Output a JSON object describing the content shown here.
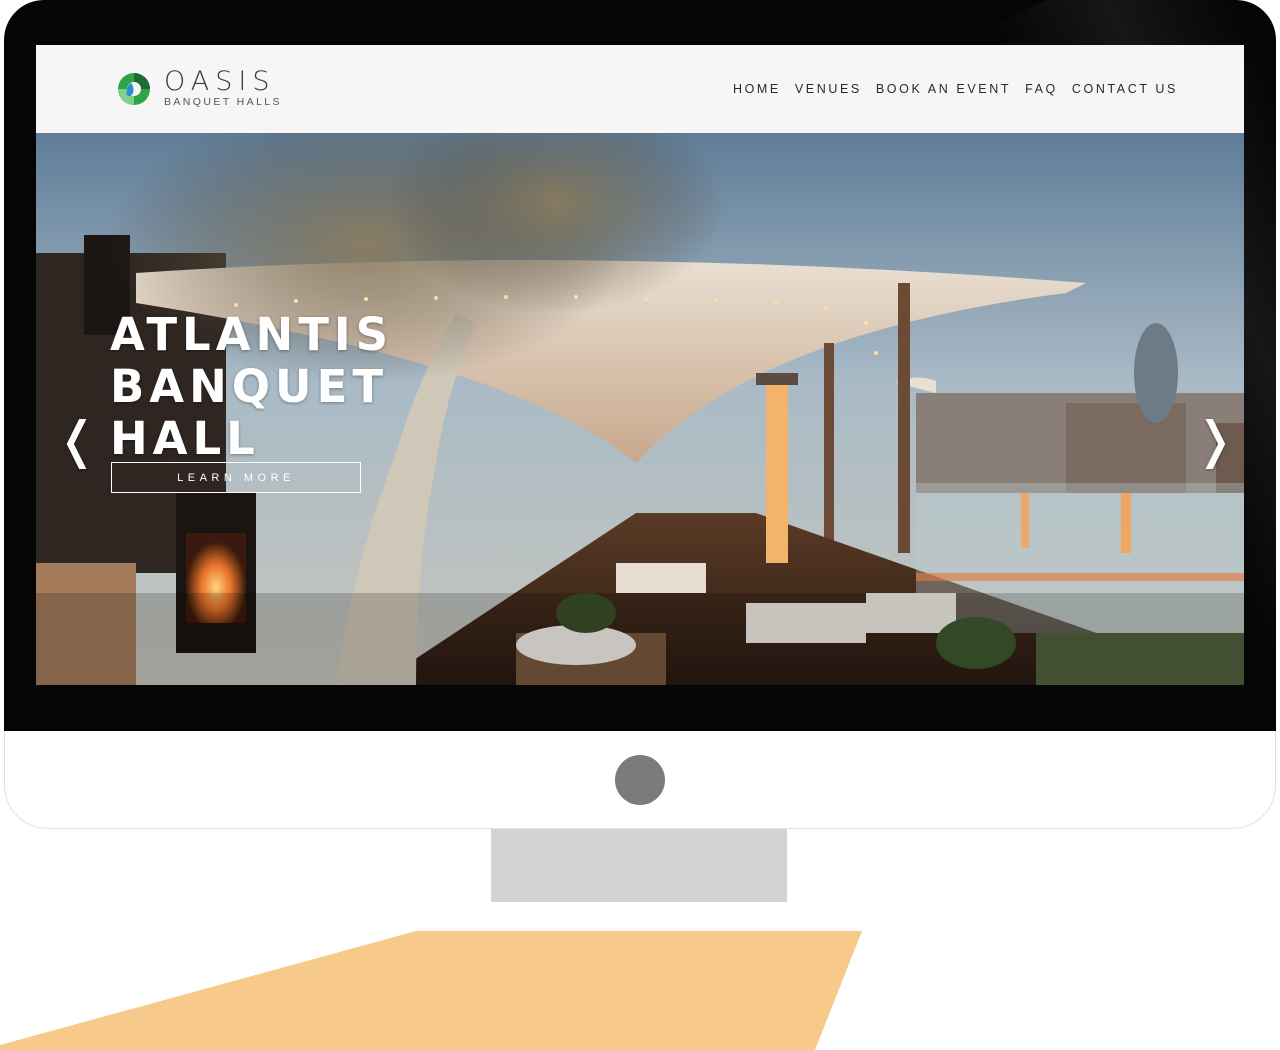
{
  "brand": {
    "name": "OASIS",
    "tagline": "BANQUET HALLS",
    "logo_icon": "swirl-drop-logo",
    "colors": {
      "green": "#2fa34a",
      "dark_green": "#1f6b34",
      "blue": "#2a8fd4"
    }
  },
  "nav": {
    "items": [
      {
        "label": "HOME"
      },
      {
        "label": "VENUES"
      },
      {
        "label": "BOOK AN EVENT"
      },
      {
        "label": "FAQ"
      },
      {
        "label": "CONTACT US"
      }
    ]
  },
  "hero": {
    "title": "ATLANTIS\nBANQUET\nHALL",
    "button_label": "LEARN MORE",
    "prev_arrow": "❬",
    "next_arrow": "❭",
    "image_subject": "rooftop-terrace-photo"
  },
  "device": {
    "frame_color": "#050505",
    "chin_color": "#ffffff",
    "camera_color": "#7b7b7b",
    "stand_color": "#d3d3d3",
    "base_color": "#f7c98b"
  }
}
